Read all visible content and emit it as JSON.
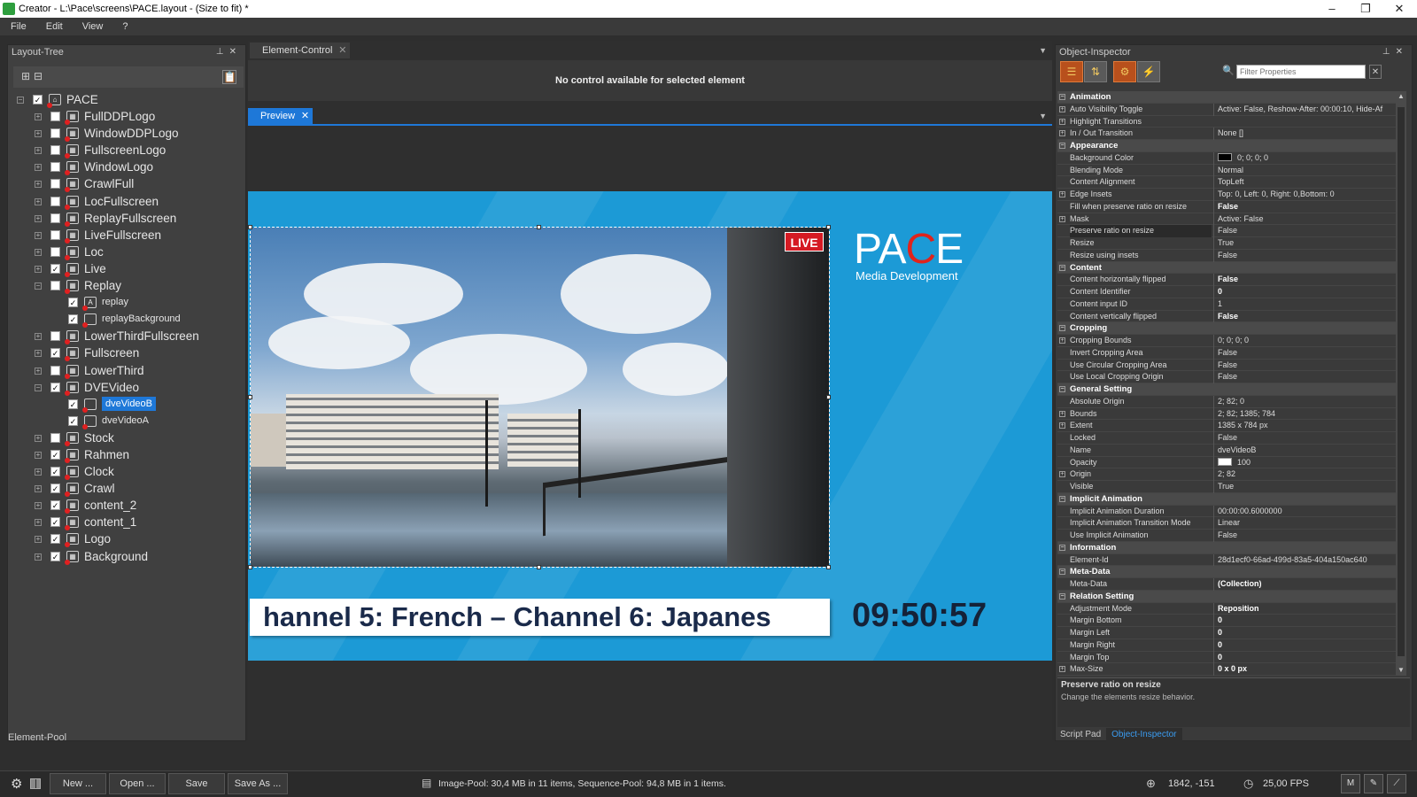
{
  "window": {
    "title": "Creator - L:\\Pace\\screens\\PACE.layout - (Size to fit) *"
  },
  "menu": [
    "File",
    "Edit",
    "View",
    "?"
  ],
  "layout_tree": {
    "title": "Layout-Tree",
    "items": [
      {
        "label": "PACE",
        "level": 0,
        "checked": true,
        "expanded": true,
        "icon": "home-icon"
      },
      {
        "label": "FullDDPLogo",
        "level": 1,
        "checked": false,
        "expanded": false
      },
      {
        "label": "WindowDDPLogo",
        "level": 1,
        "checked": false,
        "expanded": false
      },
      {
        "label": "FullscreenLogo",
        "level": 1,
        "checked": false,
        "expanded": false
      },
      {
        "label": "WindowLogo",
        "level": 1,
        "checked": false,
        "expanded": false
      },
      {
        "label": "CrawlFull",
        "level": 1,
        "checked": false,
        "expanded": false
      },
      {
        "label": "LocFullscreen",
        "level": 1,
        "checked": false,
        "expanded": false
      },
      {
        "label": "ReplayFullscreen",
        "level": 1,
        "checked": false,
        "expanded": false
      },
      {
        "label": "LiveFullscreen",
        "level": 1,
        "checked": false,
        "expanded": false
      },
      {
        "label": "Loc",
        "level": 1,
        "checked": false,
        "expanded": false
      },
      {
        "label": "Live",
        "level": 1,
        "checked": true,
        "expanded": false
      },
      {
        "label": "Replay",
        "level": 1,
        "checked": false,
        "expanded": true
      },
      {
        "label": "replay",
        "level": 2,
        "checked": true,
        "icon": "text-icon"
      },
      {
        "label": "replayBackground",
        "level": 2,
        "checked": true,
        "icon": "rect-icon"
      },
      {
        "label": "LowerThirdFullscreen",
        "level": 1,
        "checked": false,
        "expanded": false
      },
      {
        "label": "Fullscreen",
        "level": 1,
        "checked": true,
        "expanded": false
      },
      {
        "label": "LowerThird",
        "level": 1,
        "checked": false,
        "expanded": false
      },
      {
        "label": "DVEVideo",
        "level": 1,
        "checked": true,
        "expanded": true
      },
      {
        "label": "dveVideoB",
        "level": 2,
        "checked": true,
        "icon": "rect-icon",
        "selected": true
      },
      {
        "label": "dveVideoA",
        "level": 2,
        "checked": true,
        "icon": "rect-icon"
      },
      {
        "label": "Stock",
        "level": 1,
        "checked": false,
        "expanded": false
      },
      {
        "label": "Rahmen",
        "level": 1,
        "checked": true,
        "expanded": false
      },
      {
        "label": "Clock",
        "level": 1,
        "checked": true,
        "expanded": false
      },
      {
        "label": "Crawl",
        "level": 1,
        "checked": true,
        "expanded": false
      },
      {
        "label": "content_2",
        "level": 1,
        "checked": true,
        "expanded": false
      },
      {
        "label": "content_1",
        "level": 1,
        "checked": true,
        "expanded": false
      },
      {
        "label": "Logo",
        "level": 1,
        "checked": true,
        "expanded": false
      },
      {
        "label": "Background",
        "level": 1,
        "checked": true,
        "expanded": false
      }
    ]
  },
  "element_pool": "Element-Pool",
  "element_control": {
    "tab": "Element-Control",
    "message": "No control available for selected element"
  },
  "preview": {
    "tab": "Preview",
    "live_badge": "LIVE",
    "logo_main_a": "PA",
    "logo_main_c": "C",
    "logo_main_e": "E",
    "logo_sub": "Media Development",
    "ticker": "hannel 5: French   –   Channel 6: Japanes",
    "clock": "09:50:57"
  },
  "object_inspector": {
    "title": "Object-Inspector",
    "filter_placeholder": "Filter Properties",
    "rows": [
      {
        "cat": true,
        "name": "Animation"
      },
      {
        "name": "Auto Visibility Toggle",
        "value": "Active: False, Reshow-After: 00:00:10, Hide-Af",
        "exp": true
      },
      {
        "name": "Highlight Transitions",
        "value": "",
        "exp": true
      },
      {
        "name": "In / Out Transition",
        "value": "None []",
        "exp": true
      },
      {
        "cat": true,
        "name": "Appearance"
      },
      {
        "name": "Background Color",
        "value": "0; 0; 0; 0",
        "swatch": "#000000"
      },
      {
        "name": "Blending Mode",
        "value": "Normal"
      },
      {
        "name": "Content Alignment",
        "value": "TopLeft"
      },
      {
        "name": "Edge Insets",
        "value": "Top: 0, Left: 0, Right: 0,Bottom: 0",
        "exp": true
      },
      {
        "name": "Fill when preserve ratio on resize",
        "value": "False",
        "bold": true
      },
      {
        "name": "Mask",
        "value": "Active: False",
        "exp": true
      },
      {
        "name": "Preserve ratio on resize",
        "value": "False",
        "selected": true
      },
      {
        "name": "Resize",
        "value": "True"
      },
      {
        "name": "Resize using insets",
        "value": "False"
      },
      {
        "cat": true,
        "name": "Content"
      },
      {
        "name": "Content horizontally flipped",
        "value": "False",
        "bold": true
      },
      {
        "name": "Content Identifier",
        "value": "0",
        "bold": true
      },
      {
        "name": "Content input ID",
        "value": "1"
      },
      {
        "name": "Content vertically flipped",
        "value": "False",
        "bold": true
      },
      {
        "cat": true,
        "name": "Cropping"
      },
      {
        "name": "Cropping Bounds",
        "value": "0; 0; 0; 0",
        "exp": true
      },
      {
        "name": "Invert Cropping Area",
        "value": "False"
      },
      {
        "name": "Use Circular Cropping Area",
        "value": "False"
      },
      {
        "name": "Use Local Cropping Origin",
        "value": "False"
      },
      {
        "cat": true,
        "name": "General Setting"
      },
      {
        "name": "Absolute Origin",
        "value": "2; 82; 0"
      },
      {
        "name": "Bounds",
        "value": "2; 82; 1385; 784",
        "exp": true
      },
      {
        "name": "Extent",
        "value": "1385 x 784 px",
        "exp": true
      },
      {
        "name": "Locked",
        "value": "False"
      },
      {
        "name": "Name",
        "value": "dveVideoB"
      },
      {
        "name": "Opacity",
        "value": "100",
        "swatch": "#ffffff"
      },
      {
        "name": "Origin",
        "value": "2; 82",
        "exp": true
      },
      {
        "name": "Visible",
        "value": "True"
      },
      {
        "cat": true,
        "name": "Implicit Animation"
      },
      {
        "name": "Implicit Animation Duration",
        "value": "00:00:00.6000000"
      },
      {
        "name": "Implicit Animation Transition Mode",
        "value": "Linear"
      },
      {
        "name": "Use Implicit Animation",
        "value": "False"
      },
      {
        "cat": true,
        "name": "Information"
      },
      {
        "name": "Element-Id",
        "value": "28d1ecf0-66ad-499d-83a5-404a150ac640"
      },
      {
        "cat": true,
        "name": "Meta-Data"
      },
      {
        "name": "Meta-Data",
        "value": "(Collection)",
        "bold": true
      },
      {
        "cat": true,
        "name": "Relation Setting"
      },
      {
        "name": "Adjustment Mode",
        "value": "Reposition",
        "bold": true
      },
      {
        "name": "Margin Bottom",
        "value": "0",
        "bold": true
      },
      {
        "name": "Margin Left",
        "value": "0",
        "bold": true
      },
      {
        "name": "Margin Right",
        "value": "0",
        "bold": true
      },
      {
        "name": "Margin Top",
        "value": "0",
        "bold": true
      },
      {
        "name": "Max-Size",
        "value": "0 x 0 px",
        "bold": true,
        "exp": true
      }
    ],
    "desc_title": "Preserve ratio on resize",
    "desc_text": "Change the elements resize behavior.",
    "bottom_tabs": [
      "Script Pad",
      "Object-Inspector"
    ]
  },
  "statusbar": {
    "buttons": [
      "New ...",
      "Open ...",
      "Save",
      "Save As ..."
    ],
    "pool_info": "Image-Pool: 30,4 MB in 11 items, Sequence-Pool: 94,8 MB in 1 items.",
    "coords": "1842, -151",
    "fps": "25,00 FPS",
    "mode_button": "M"
  },
  "colors": {
    "accent": "#1e78d8",
    "stage": "#1c9ad6",
    "live": "#d51a23",
    "logo_c": "#e0231c"
  }
}
